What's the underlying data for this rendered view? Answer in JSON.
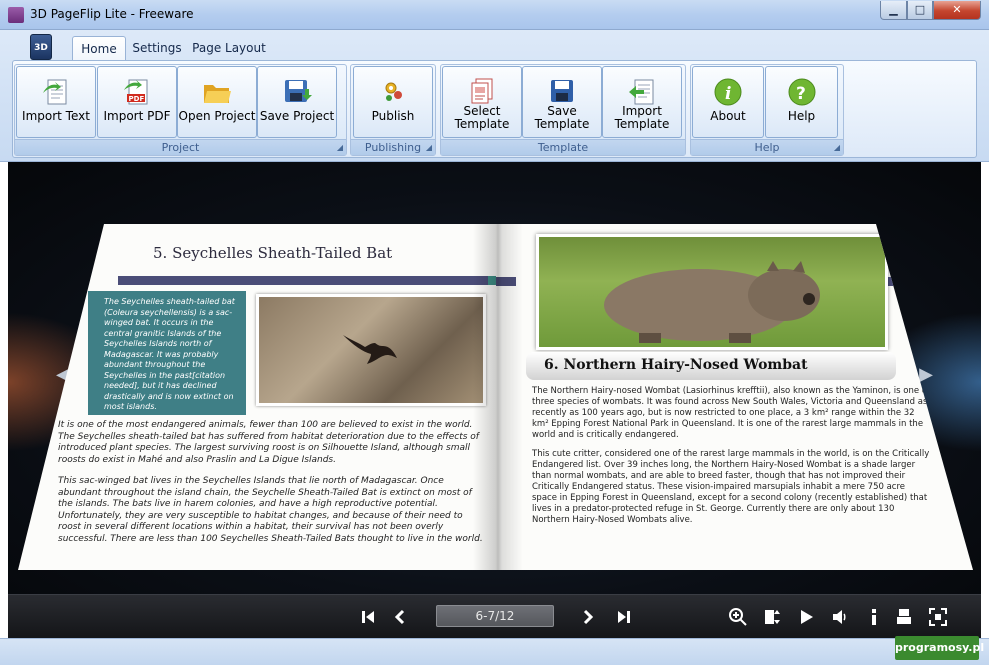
{
  "window": {
    "title": "3D PageFlip Lite - Freeware",
    "app_icon": "app-icon",
    "minimize": "▁",
    "maximize": "□",
    "close": "✕"
  },
  "ribbon": {
    "app_button": "3D",
    "tabs": [
      {
        "label": "Home",
        "active": true
      },
      {
        "label": "Settings",
        "active": false
      },
      {
        "label": "Page Layout",
        "active": false
      }
    ],
    "groups": {
      "project": {
        "label": "Project",
        "buttons": [
          {
            "label": "Import Text",
            "icon": "import-text-icon"
          },
          {
            "label": "Import PDF",
            "icon": "import-pdf-icon"
          },
          {
            "label": "Open Project",
            "icon": "open-folder-icon"
          },
          {
            "label": "Save Project",
            "icon": "save-project-icon"
          }
        ]
      },
      "publishing": {
        "label": "Publishing",
        "buttons": [
          {
            "label": "Publish",
            "icon": "publish-icon"
          }
        ]
      },
      "template": {
        "label": "Template",
        "buttons": [
          {
            "label": "Select",
            "label2": "Template",
            "icon": "select-template-icon"
          },
          {
            "label": "Save",
            "label2": "Template",
            "icon": "save-template-icon"
          },
          {
            "label": "Import",
            "label2": "Template",
            "icon": "import-template-icon"
          }
        ]
      },
      "help": {
        "label": "Help",
        "buttons": [
          {
            "label": "About",
            "icon": "info-icon"
          },
          {
            "label": "Help",
            "icon": "help-icon"
          }
        ]
      }
    }
  },
  "book": {
    "left_page": {
      "title": "5. Seychelles Sheath-Tailed Bat",
      "sidebar_text": "The Seychelles sheath-tailed bat (Coleura seychellensis) is a sac-winged bat. It occurs in the central granitic Islands of the Seychelles Islands north of Madagascar. It was probably abundant throughout the Seychelles in the past[citation needed], but it has declined drastically and is now extinct on most islands.",
      "paragraph1": "It is one of the most endangered animals, fewer than 100 are believed to exist in the world. The Seychelles sheath-tailed bat has suffered from habitat deterioration due to the effects of introduced plant species. The largest surviving roost is on Silhouette Island, although small roosts do exist in Mahé and also Praslin and La Digue Islands.",
      "paragraph2": "This sac-winged bat lives in the Seychelles Islands that lie north of Madagascar. Once abundant throughout the island chain, the Seychelle Sheath-Tailed Bat is extinct on most of the islands. The bats live in harem colonies, and have a high reproductive potential. Unfortunately, they are very susceptible to habitat changes, and because of their need to roost in several different locations within a habitat, their survival has not been overly successful. There are less than 100 Seychelles Sheath-Tailed Bats thought to live in the world."
    },
    "right_page": {
      "title": "6. Northern Hairy-Nosed Wombat",
      "paragraph1": "The Northern Hairy-nosed Wombat (Lasiorhinus krefftii), also known as the Yaminon, is one of three species of wombats. It was found across New South Wales, Victoria and Queensland as recently as 100 years ago, but is now restricted to one place, a 3 km² range within the 32 km² Epping Forest National Park in Queensland. It is one of the rarest large mammals in the world and is critically endangered.",
      "paragraph2": "This cute critter, considered one of the rarest large mammals in the world, is on the Critically Endangered list. Over 39 inches long, the Northern Hairy-Nosed Wombat is a shade larger than normal wombats, and are able to breed faster, though that has not improved their Critically Endangered status. These vision-impaired marsupials inhabit a mere 750 acre space in Epping Forest in Queensland, except for a second colony (recently established) that lives in a predator-protected refuge in St. George. Currently there are only about 130 Northern Hairy-Nosed Wombats alive."
    }
  },
  "viewer_nav": {
    "prev": "◀",
    "next": "▶"
  },
  "toolbar": {
    "first": "K",
    "prev": "‹",
    "page_indicator": "6-7/12",
    "next": "›",
    "last": "›I",
    "icons": [
      "zoom-in-icon",
      "fit-page-icon",
      "autoplay-icon",
      "sound-icon",
      "info-icon",
      "print-icon",
      "fullscreen-icon"
    ]
  },
  "watermark": "programosy.pl"
}
